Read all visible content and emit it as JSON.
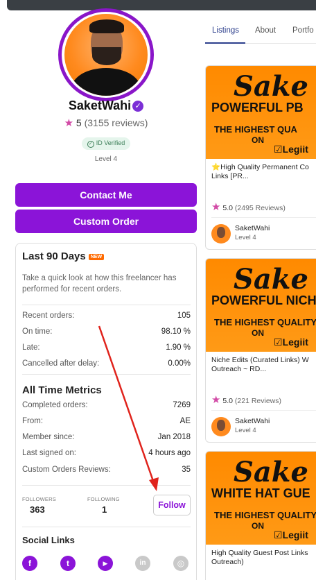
{
  "profile": {
    "name": "SaketWahi",
    "rating": "5",
    "reviews": "(3155 reviews)",
    "id_badge": "ID Verified",
    "level": "Level 4"
  },
  "actions": {
    "contact": "Contact Me",
    "custom_order": "Custom Order"
  },
  "recent": {
    "title": "Last 90 Days",
    "new_badge": "NEW",
    "description": "Take a quick look at how this freelancer has performed for recent orders.",
    "rows": [
      {
        "label": "Recent orders:",
        "value": "105"
      },
      {
        "label": "On time:",
        "value": "98.10 %"
      },
      {
        "label": "Late:",
        "value": "1.90 %"
      },
      {
        "label": "Cancelled after delay:",
        "value": "0.00%"
      }
    ]
  },
  "alltime": {
    "title": "All Time Metrics",
    "rows": [
      {
        "label": "Completed orders:",
        "value": "7269"
      },
      {
        "label": "From:",
        "value": "AE"
      },
      {
        "label": "Member since:",
        "value": "Jan 2018"
      },
      {
        "label": "Last signed on:",
        "value": "4 hours ago"
      },
      {
        "label": "Custom Orders Reviews:",
        "value": "35"
      }
    ]
  },
  "social_stats": {
    "followers_label": "FOLLOWERS",
    "followers": "363",
    "following_label": "FOLLOWING",
    "following": "1",
    "follow_button": "Follow"
  },
  "social_links": {
    "title": "Social Links",
    "icons": [
      "facebook-icon",
      "twitter-icon",
      "youtube-icon",
      "linkedin-icon",
      "instagram-icon"
    ],
    "glyphs": [
      "f",
      "t",
      "▶",
      "in",
      "◎"
    ]
  },
  "tabs": [
    "Listings",
    "About",
    "Portfo"
  ],
  "listings": [
    {
      "thumb_script": "Sake",
      "thumb_line2": "POWERFUL PB",
      "thumb_line3": "THE HIGHEST QUA",
      "thumb_on": "ON",
      "thumb_brand": "Legiit",
      "title": "⭐High Quality Permanent Co Links [PR...",
      "rating": "5.0",
      "reviews": "(2495 Reviews)",
      "seller": "SaketWahi",
      "level": "Level 4"
    },
    {
      "thumb_script": "Sake",
      "thumb_line2": "POWERFUL NICHE",
      "thumb_line3": "THE HIGHEST QUALITY",
      "thumb_on": "ON",
      "thumb_brand": "Legiit",
      "title": "Niche Edits (Curated Links) W Outreach ~ RD...",
      "rating": "5.0",
      "reviews": "(221 Reviews)",
      "seller": "SaketWahi",
      "level": "Level 4"
    },
    {
      "thumb_script": "Sake",
      "thumb_line2": "WHITE HAT GUE",
      "thumb_line3": "THE HIGHEST QUALITY",
      "thumb_on": "ON",
      "thumb_brand": "Legiit",
      "title": "High Quality Guest Post Links Outreach)",
      "rating": "",
      "reviews": "",
      "seller": "",
      "level": ""
    }
  ],
  "colors": {
    "accent": "#8b14d8",
    "tab_active": "#2c3e8c",
    "thumb_orange": "#ff8a00",
    "star": "#d24aa6",
    "annotation_arrow": "#e0231c"
  }
}
